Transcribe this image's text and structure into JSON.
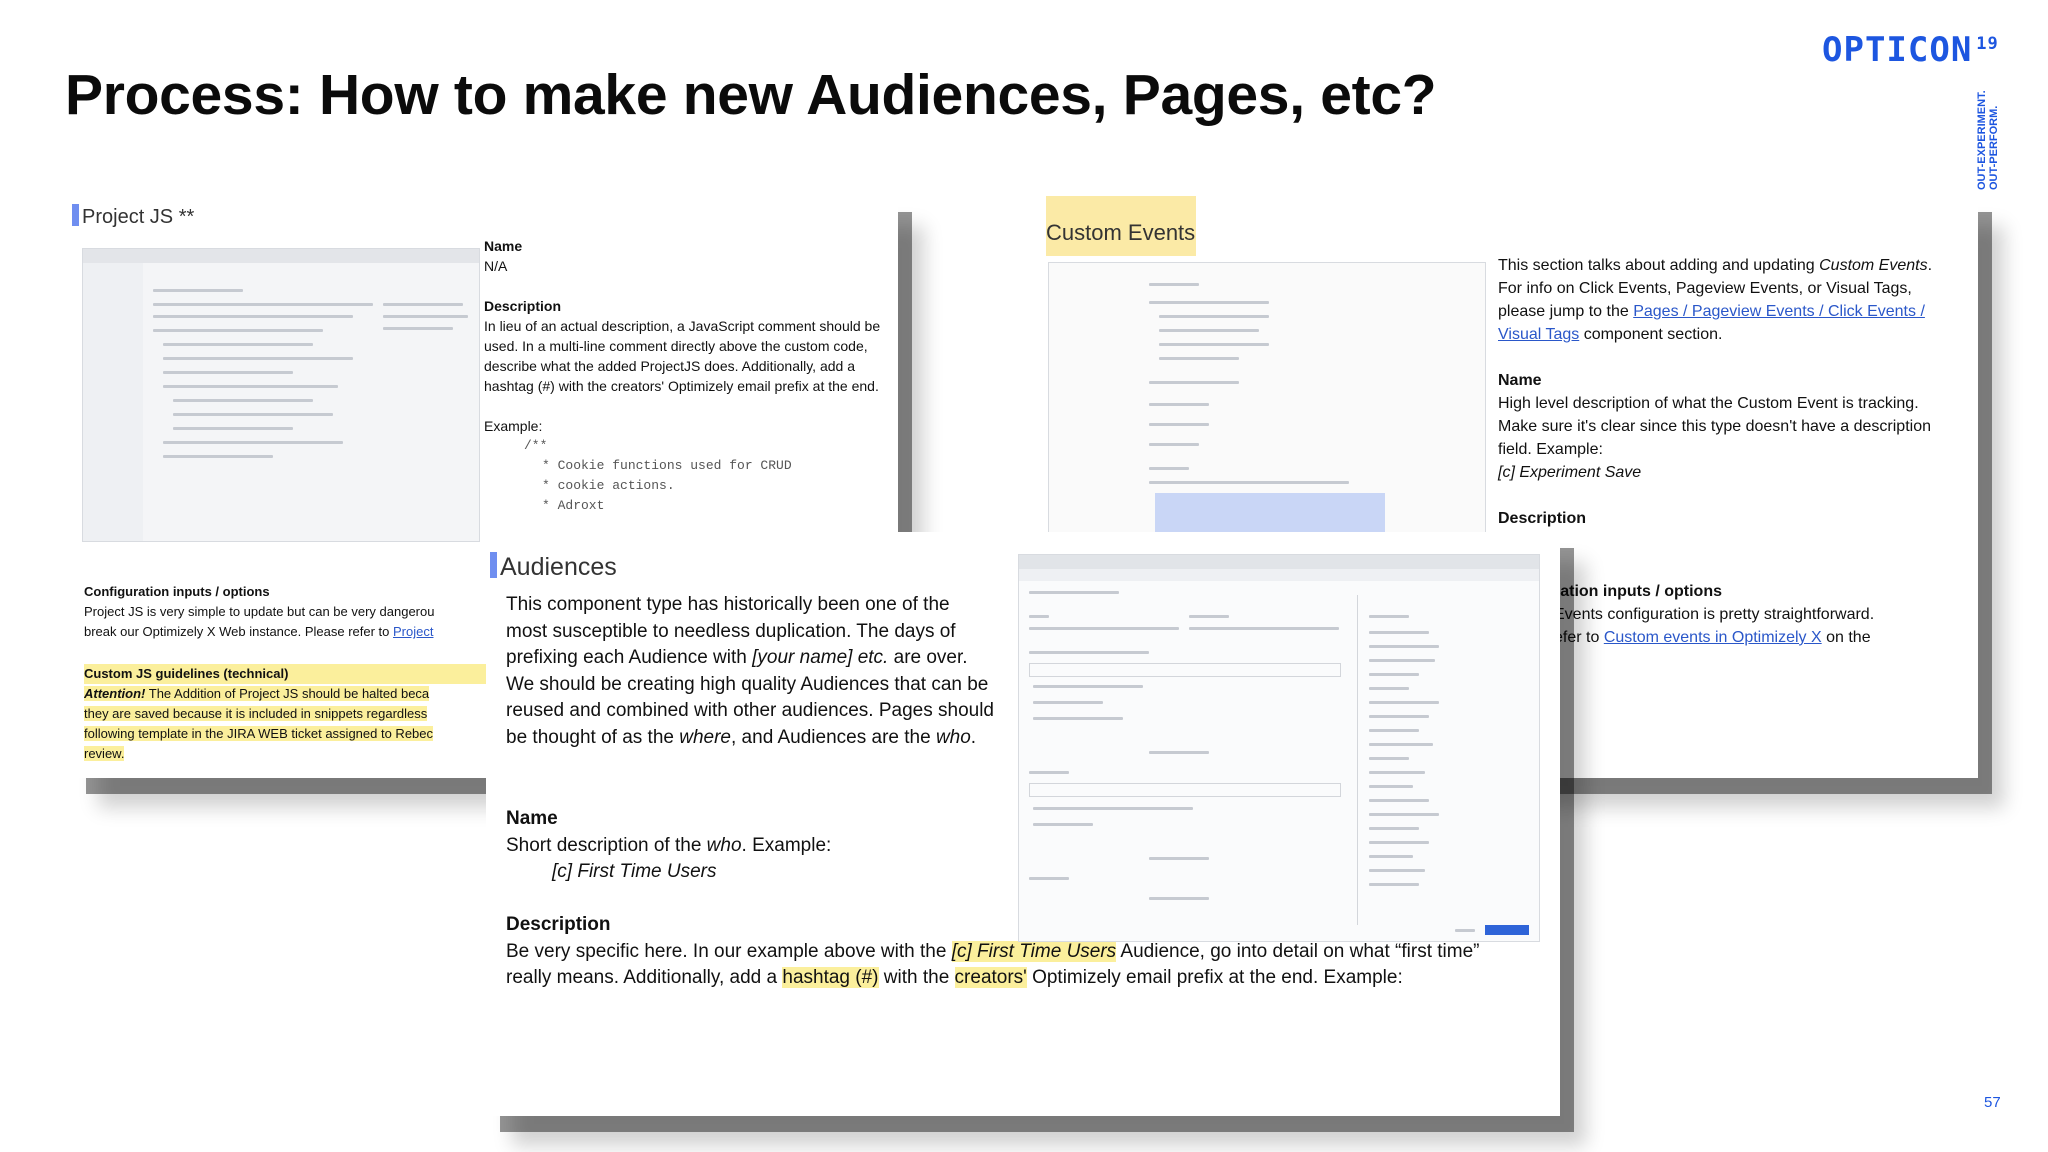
{
  "slide": {
    "title": "Process: How to make new Audiences, Pages, etc?",
    "logo": "OPTICON",
    "logo_sup": "19",
    "tagline_1": "OUT-EXPERIMENT.",
    "tagline_2": "OUT-PERFORM.",
    "page_number": "57"
  },
  "project_js": {
    "title": "Project JS **",
    "name_label": "Name",
    "name_value": "N/A",
    "desc_label": "Description",
    "desc_text": "In lieu of an actual description, a JavaScript comment should be used. In a multi-line comment directly above the custom code, describe what the added ProjectJS does. Additionally, add a hashtag (#) with the creators' Optimizely email prefix at the end.",
    "example_label": "Example:",
    "code_1": "/**",
    "code_2": "* Cookie functions used for CRUD",
    "code_3": "* cookie actions.",
    "code_4": "* Adroxt",
    "config_label": "Configuration inputs / options",
    "config_text_1": "Project JS is very simple to update but can be very dangerou",
    "config_text_2a": "break our Optimizely X Web instance. Please refer to ",
    "config_link": "Project",
    "guide_label": "Custom JS guidelines (technical)",
    "guide_attention": "Attention!",
    "guide_text_1": " The Addition of Project JS should be halted beca",
    "guide_text_2": "they are saved because it is included in snippets regardless",
    "guide_text_3": "following template in the JIRA WEB ticket assigned to Rebec",
    "guide_text_4": "review."
  },
  "custom_events": {
    "title": "Custom Events",
    "intro_1": "This section talks about adding and updating ",
    "intro_em": "Custom Events",
    "intro_2": ". For info on Click Events, Pageview Events, or Visual Tags, please jump to the ",
    "intro_link": "Pages / Pageview Events / Click Events / Visual Tags",
    "intro_3": " component section.",
    "name_label": "Name",
    "name_text": "High level description of what the Custom Event is tracking. Make sure it's clear since this type doesn't have a description field. Example:",
    "name_example": "[c] Experiment Save",
    "desc_label": "Description",
    "config_label": "ration inputs / options",
    "config_text_1": "Events configuration is pretty straightforward.",
    "config_text_2a": "efer to ",
    "config_link": "Custom events in Optimizely X",
    "config_text_2b": " on the"
  },
  "audiences": {
    "title": "Audiences",
    "intro_1": "This component type has historically been one of the most susceptible to needless duplication. The days of prefixing each Audience with ",
    "intro_em1": "[your name] etc.",
    "intro_2": " are over. We should be creating high quality Audiences that can be reused and combined with other audiences. Pages should be thought of as the ",
    "intro_em2": "where",
    "intro_3": ", and Audiences are the ",
    "intro_em3": "who",
    "intro_4": ".",
    "name_label": "Name",
    "name_text_1": "Short description of the ",
    "name_em": "who",
    "name_text_2": ". Example:",
    "name_example": "[c] First Time Users",
    "desc_label": "Description",
    "desc_1": "Be very specific here. In our example above with the ",
    "desc_hl1": "[c] First Time Users",
    "desc_2": " Audience, go into detail on what “first time” really means. Additionally, add a ",
    "desc_hl2": "hashtag (#)",
    "desc_3": " with the ",
    "desc_hl3": "creators'",
    "desc_4": " Optimizely email prefix at the end. Example:"
  }
}
